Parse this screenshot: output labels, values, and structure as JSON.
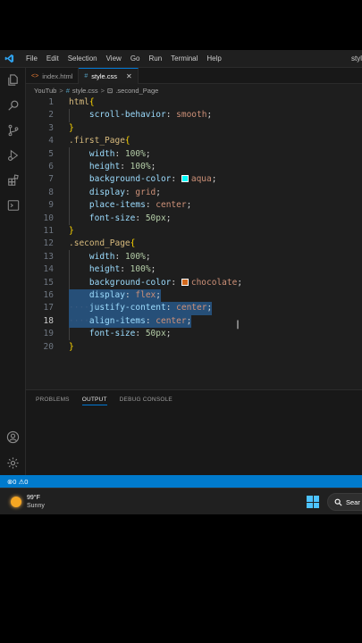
{
  "window": {
    "title": "styl",
    "menu": [
      "File",
      "Edit",
      "Selection",
      "View",
      "Go",
      "Run",
      "Terminal",
      "Help"
    ]
  },
  "tabs": [
    {
      "label": "index.html",
      "icon": "html-file-icon",
      "active": false
    },
    {
      "label": "style.css",
      "icon": "css-file-icon",
      "active": true,
      "close": "✕"
    }
  ],
  "breadcrumb": {
    "folder": "YouTub",
    "file": "style.css",
    "symbol": ".second_Page",
    "separator": ">"
  },
  "editor": {
    "lines": [
      {
        "n": "1",
        "tokens": [
          {
            "t": "html",
            "c": "tk-sel"
          },
          {
            "t": "{",
            "c": "tk-brace"
          }
        ]
      },
      {
        "n": "2",
        "tokens": [
          {
            "t": "    ",
            "c": ""
          },
          {
            "t": "scroll-behavior",
            "c": "tk-prop"
          },
          {
            "t": ": ",
            "c": "tk-punc"
          },
          {
            "t": "smooth",
            "c": "tk-val"
          },
          {
            "t": ";",
            "c": "tk-punc"
          }
        ]
      },
      {
        "n": "3",
        "tokens": [
          {
            "t": "}",
            "c": "tk-brace"
          }
        ]
      },
      {
        "n": "4",
        "tokens": [
          {
            "t": ".first_Page",
            "c": "tk-sel"
          },
          {
            "t": "{",
            "c": "tk-brace"
          }
        ]
      },
      {
        "n": "5",
        "tokens": [
          {
            "t": "    ",
            "c": ""
          },
          {
            "t": "width",
            "c": "tk-prop"
          },
          {
            "t": ": ",
            "c": "tk-punc"
          },
          {
            "t": "100%",
            "c": "tk-num"
          },
          {
            "t": ";",
            "c": "tk-punc"
          }
        ]
      },
      {
        "n": "6",
        "tokens": [
          {
            "t": "    ",
            "c": ""
          },
          {
            "t": "height",
            "c": "tk-prop"
          },
          {
            "t": ": ",
            "c": "tk-punc"
          },
          {
            "t": "100%",
            "c": "tk-num"
          },
          {
            "t": ";",
            "c": "tk-punc"
          }
        ]
      },
      {
        "n": "7",
        "tokens": [
          {
            "t": "    ",
            "c": ""
          },
          {
            "t": "background-color",
            "c": "tk-prop"
          },
          {
            "t": ": ",
            "c": "tk-punc"
          },
          {
            "swatch": "#00ffff"
          },
          {
            "t": "aqua",
            "c": "tk-val"
          },
          {
            "t": ";",
            "c": "tk-punc"
          }
        ]
      },
      {
        "n": "8",
        "tokens": [
          {
            "t": "    ",
            "c": ""
          },
          {
            "t": "display",
            "c": "tk-prop"
          },
          {
            "t": ": ",
            "c": "tk-punc"
          },
          {
            "t": "grid",
            "c": "tk-val"
          },
          {
            "t": ";",
            "c": "tk-punc"
          }
        ]
      },
      {
        "n": "9",
        "tokens": [
          {
            "t": "    ",
            "c": ""
          },
          {
            "t": "place-items",
            "c": "tk-prop"
          },
          {
            "t": ": ",
            "c": "tk-punc"
          },
          {
            "t": "center",
            "c": "tk-val"
          },
          {
            "t": ";",
            "c": "tk-punc"
          }
        ]
      },
      {
        "n": "10",
        "tokens": [
          {
            "t": "    ",
            "c": ""
          },
          {
            "t": "font-size",
            "c": "tk-prop"
          },
          {
            "t": ": ",
            "c": "tk-punc"
          },
          {
            "t": "50px",
            "c": "tk-num"
          },
          {
            "t": ";",
            "c": "tk-punc"
          }
        ]
      },
      {
        "n": "11",
        "tokens": [
          {
            "t": "}",
            "c": "tk-brace"
          }
        ]
      },
      {
        "n": "12",
        "tokens": [
          {
            "t": ".second_Page",
            "c": "tk-sel"
          },
          {
            "t": "{",
            "c": "tk-brace"
          }
        ]
      },
      {
        "n": "13",
        "tokens": [
          {
            "t": "    ",
            "c": ""
          },
          {
            "t": "width",
            "c": "tk-prop"
          },
          {
            "t": ": ",
            "c": "tk-punc"
          },
          {
            "t": "100%",
            "c": "tk-num"
          },
          {
            "t": ";",
            "c": "tk-punc"
          }
        ]
      },
      {
        "n": "14",
        "tokens": [
          {
            "t": "    ",
            "c": ""
          },
          {
            "t": "height",
            "c": "tk-prop"
          },
          {
            "t": ": ",
            "c": "tk-punc"
          },
          {
            "t": "100%",
            "c": "tk-num"
          },
          {
            "t": ";",
            "c": "tk-punc"
          }
        ]
      },
      {
        "n": "15",
        "tokens": [
          {
            "t": "    ",
            "c": ""
          },
          {
            "t": "background-color",
            "c": "tk-prop"
          },
          {
            "t": ": ",
            "c": "tk-punc"
          },
          {
            "swatch": "#d2691e"
          },
          {
            "t": "chocolate",
            "c": "tk-val"
          },
          {
            "t": ";",
            "c": "tk-punc"
          }
        ]
      },
      {
        "n": "16",
        "sel": true,
        "tokens": [
          {
            "t": "    ",
            "c": ""
          },
          {
            "t": "display",
            "c": "tk-prop"
          },
          {
            "t": ": ",
            "c": "tk-punc"
          },
          {
            "t": "flex",
            "c": "tk-val"
          },
          {
            "t": ";",
            "c": "tk-punc"
          }
        ]
      },
      {
        "n": "17",
        "sel": true,
        "tokens": [
          {
            "t": "····",
            "c": "sel-dots"
          },
          {
            "t": "justify-content",
            "c": "tk-prop"
          },
          {
            "t": ": ",
            "c": "tk-punc"
          },
          {
            "t": "center",
            "c": "tk-val"
          },
          {
            "t": ";",
            "c": "tk-punc"
          }
        ]
      },
      {
        "n": "18",
        "sel": true,
        "cur": true,
        "tokens": [
          {
            "t": "····",
            "c": "sel-dots"
          },
          {
            "t": "align-items",
            "c": "tk-prop"
          },
          {
            "t": ": ",
            "c": "tk-punc"
          },
          {
            "t": "center",
            "c": "tk-val"
          },
          {
            "t": ";",
            "c": "tk-punc"
          }
        ]
      },
      {
        "n": "19",
        "tokens": [
          {
            "t": "    ",
            "c": ""
          },
          {
            "t": "font-size",
            "c": "tk-prop"
          },
          {
            "t": ": ",
            "c": "tk-punc"
          },
          {
            "t": "50px",
            "c": "tk-num"
          },
          {
            "t": ";",
            "c": "tk-punc"
          }
        ]
      },
      {
        "n": "20",
        "tokens": [
          {
            "t": "}",
            "c": "tk-brace"
          }
        ]
      }
    ]
  },
  "panel": {
    "tabs": [
      {
        "label": "PROBLEMS",
        "active": false
      },
      {
        "label": "OUTPUT",
        "active": true
      },
      {
        "label": "DEBUG CONSOLE",
        "active": false
      }
    ]
  },
  "statusbar": {
    "errors": "0",
    "warnings": "0"
  },
  "taskbar": {
    "temperature": "99°F",
    "condition": "Sunny",
    "search_label": "Sear"
  },
  "colors": {
    "accent": "#007acc",
    "editor_bg": "#1e1e1e",
    "selection": "#264f78"
  }
}
